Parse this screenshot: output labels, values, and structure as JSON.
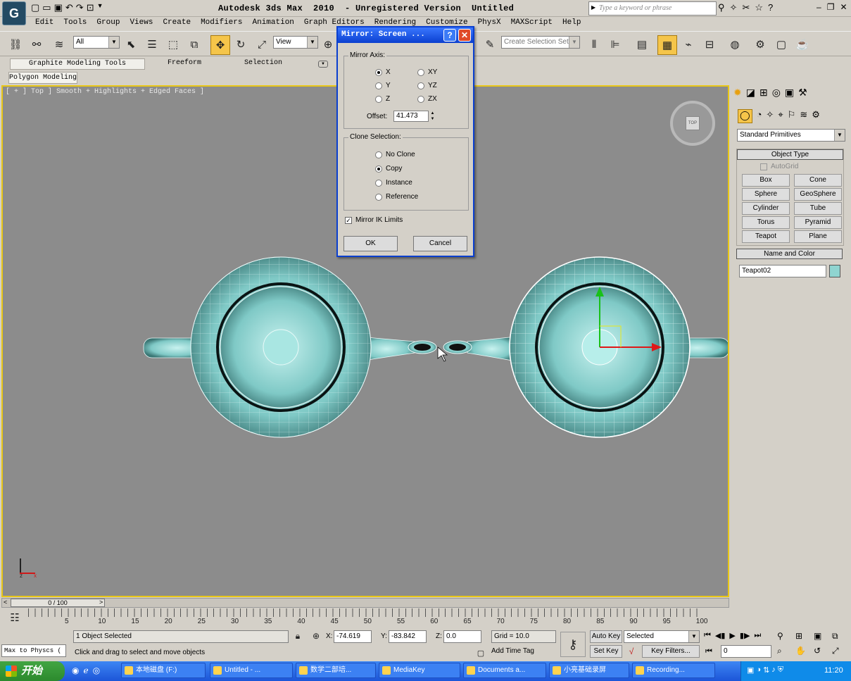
{
  "app": {
    "title": "Autodesk 3ds Max  2010  - Unregistered Version  Untitled",
    "search_placeholder": "Type a keyword or phrase",
    "logo": "3ds-max-logo"
  },
  "menu": [
    "Edit",
    "Tools",
    "Group",
    "Views",
    "Create",
    "Modifiers",
    "Animation",
    "Graph Editors",
    "Rendering",
    "Customize",
    "PhysX",
    "MAXScript",
    "Help"
  ],
  "toolbar": {
    "selection_filter": "All",
    "ref_coord": "View",
    "named_selection": "Create Selection Set"
  },
  "ribbon": {
    "tabs": [
      "Graphite Modeling Tools",
      "Freeform",
      "Selection"
    ],
    "subtab": "Polygon Modeling"
  },
  "viewport": {
    "label": "[ + ] Top ] Smooth + Highlights + Edged Faces ]",
    "viewcube": "TOP",
    "axis_x": "x",
    "axis_z": "z"
  },
  "dialog": {
    "title": "Mirror: Screen ...",
    "mirror_axis_label": "Mirror Axis:",
    "axes": [
      {
        "label": "X",
        "checked": true
      },
      {
        "label": "XY",
        "checked": false
      },
      {
        "label": "Y",
        "checked": false
      },
      {
        "label": "YZ",
        "checked": false
      },
      {
        "label": "Z",
        "checked": false
      },
      {
        "label": "ZX",
        "checked": false
      }
    ],
    "offset_label": "Offset:",
    "offset_value": "41.473",
    "clone_label": "Clone Selection:",
    "clone_options": [
      {
        "label": "No Clone",
        "checked": false
      },
      {
        "label": "Copy",
        "checked": true
      },
      {
        "label": "Instance",
        "checked": false
      },
      {
        "label": "Reference",
        "checked": false
      }
    ],
    "mirror_ik": "Mirror IK Limits",
    "ok": "OK",
    "cancel": "Cancel"
  },
  "panel": {
    "category": "Standard Primitives",
    "object_type": "Object Type",
    "autogrid": "AutoGrid",
    "buttons": [
      "Box",
      "Cone",
      "Sphere",
      "GeoSphere",
      "Cylinder",
      "Tube",
      "Torus",
      "Pyramid",
      "Teapot",
      "Plane"
    ],
    "name_color": "Name and Color",
    "object_name": "Teapot02",
    "object_color": "#8fd4d0"
  },
  "timeline": {
    "slider": "0 / 100",
    "ticks": [
      "5",
      "10",
      "15",
      "20",
      "25",
      "30",
      "35",
      "40",
      "45",
      "50",
      "55",
      "60",
      "65",
      "70",
      "75",
      "80",
      "85",
      "90",
      "95",
      "100"
    ]
  },
  "status": {
    "maxscript": "Max to Physcs (",
    "selected": "1 Object Selected",
    "prompt": "Click and drag to select and move objects",
    "x": "-74.619",
    "y": "-83.842",
    "z": "0.0",
    "grid": "Grid = 10.0",
    "add_time_tag": "Add Time Tag",
    "auto_key": "Auto Key",
    "set_key": "Set Key",
    "key_mode": "Selected",
    "key_filters": "Key Filters...",
    "frame": "0"
  },
  "taskbar": {
    "start": "开始",
    "items": [
      "本地磁盘 (F:)",
      "Untitled - ...",
      "数学二部培...",
      "MediaKey",
      "Documents a...",
      "小亮基础录屏",
      "Recording..."
    ],
    "clock": "11:20"
  }
}
